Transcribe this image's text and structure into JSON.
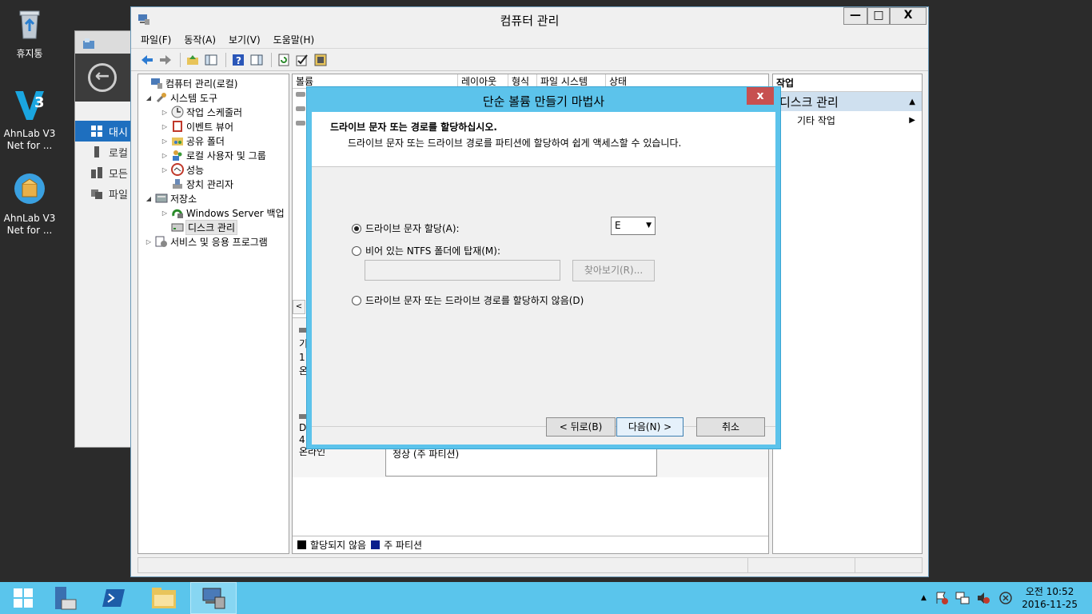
{
  "desktop": {
    "recycle_bin": "휴지통",
    "ahnlab1": "AhnLab V3 Net for ...",
    "ahnlab2": "AhnLab V3 Net for ..."
  },
  "bg_window": {
    "nav": [
      "대시",
      "로컬",
      "모든",
      "파일"
    ]
  },
  "window": {
    "title": "컴퓨터 관리",
    "minimize": "—",
    "maximize": "□",
    "close": "X",
    "menu": [
      "파일(F)",
      "동작(A)",
      "보기(V)",
      "도움말(H)"
    ]
  },
  "tree": {
    "root": "컴퓨터 관리(로컬)",
    "system_tools": "시스템 도구",
    "task_scheduler": "작업 스케줄러",
    "event_viewer": "이벤트 뷰어",
    "shared_folders": "공유 폴더",
    "local_users": "로컬 사용자 및 그룹",
    "performance": "성능",
    "device_manager": "장치 관리자",
    "storage": "저장소",
    "backup": "Windows Server 백업",
    "disk_mgmt": "디스크 관리",
    "services": "서비스 및 응용 프로그램"
  },
  "center": {
    "columns": [
      "볼륨",
      "레이아웃",
      "형식",
      "파일 시스템",
      "상태"
    ],
    "disk_labels": [
      "기",
      "1",
      "온"
    ],
    "disk2_labels": [
      "D",
      "4",
      "온라인"
    ],
    "partition_status": "정상 (주 파티션)",
    "legend_unallocated": "할당되지 않음",
    "legend_primary": "주 파티션"
  },
  "actions": {
    "header": "작업",
    "section": "디스크 관리",
    "more": "기타 작업"
  },
  "dialog": {
    "title": "단순 볼륨 만들기 마법사",
    "close": "x",
    "heading": "드라이브 문자 또는 경로를 할당하십시오.",
    "subheading": "드라이브 문자 또는 드라이브 경로를 파티션에 할당하여 쉽게 액세스할 수 있습니다.",
    "option_assign": "드라이브 문자 할당(A):",
    "drive_letter": "E",
    "option_mount": "비어 있는 NTFS 폴더에 탑재(M):",
    "browse": "찾아보기(R)...",
    "option_none": "드라이브 문자 또는 드라이브 경로를 할당하지 않음(D)",
    "back": "< 뒤로(B)",
    "next": "다음(N) >",
    "cancel": "취소"
  },
  "taskbar": {
    "time": "오전 10:52",
    "date": "2016-11-25"
  },
  "colors": {
    "dialog_frame": "#5cc3eb",
    "taskbar": "#5ac5ec",
    "legend_unallocated": "#000000",
    "legend_primary": "#0a1e8c"
  }
}
